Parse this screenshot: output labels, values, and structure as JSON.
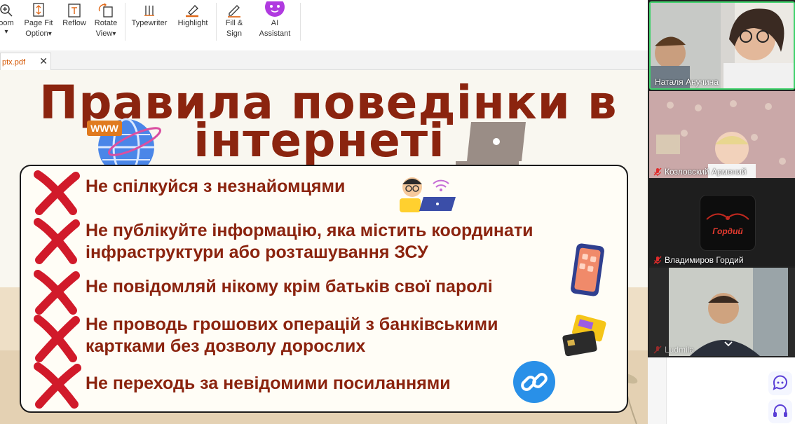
{
  "toolbar": {
    "zoom_label": "oom",
    "pagefit_line1": "Page Fit",
    "pagefit_line2": "Option",
    "reflow_label": "Reflow",
    "rotate_line1": "Rotate",
    "rotate_line2": "View",
    "typewriter_label": "Typewriter",
    "highlight_label": "Highlight",
    "fillsign_line1": "Fill &",
    "fillsign_line2": "Sign",
    "ai_line1": "AI",
    "ai_line2": "Assistant",
    "dropdown_glyph": "▾"
  },
  "tab": {
    "filename": "ptx.pdf",
    "close_glyph": "✕"
  },
  "slide": {
    "title_line1": "Правила поведінки в",
    "title_line2": "інтернеті",
    "globe_tag": "WWW",
    "rules": [
      "Не спілкуйся з незнайомцями",
      "Не публікуйте інформацію, яка містить координати",
      "інфраструктури або розташування ЗСУ",
      "Не повідомляй нікому крім батьків свої паролі",
      "Не проводь грошових операцій з банківськими",
      "картками без дозволу дорослих",
      "Не переходь за невідомими посиланнями"
    ]
  },
  "participants": [
    {
      "name": "Наталя Анучина"
    },
    {
      "name": "Козловский Армений"
    },
    {
      "name": "Владимиров Гордий",
      "logo_text": "Гордий"
    },
    {
      "name": "Ludmila"
    }
  ],
  "colors": {
    "title": "#8b240f",
    "x_mark": "#d11a2a",
    "highlight_border": "#3fd16b",
    "tab_text": "#d35400"
  }
}
